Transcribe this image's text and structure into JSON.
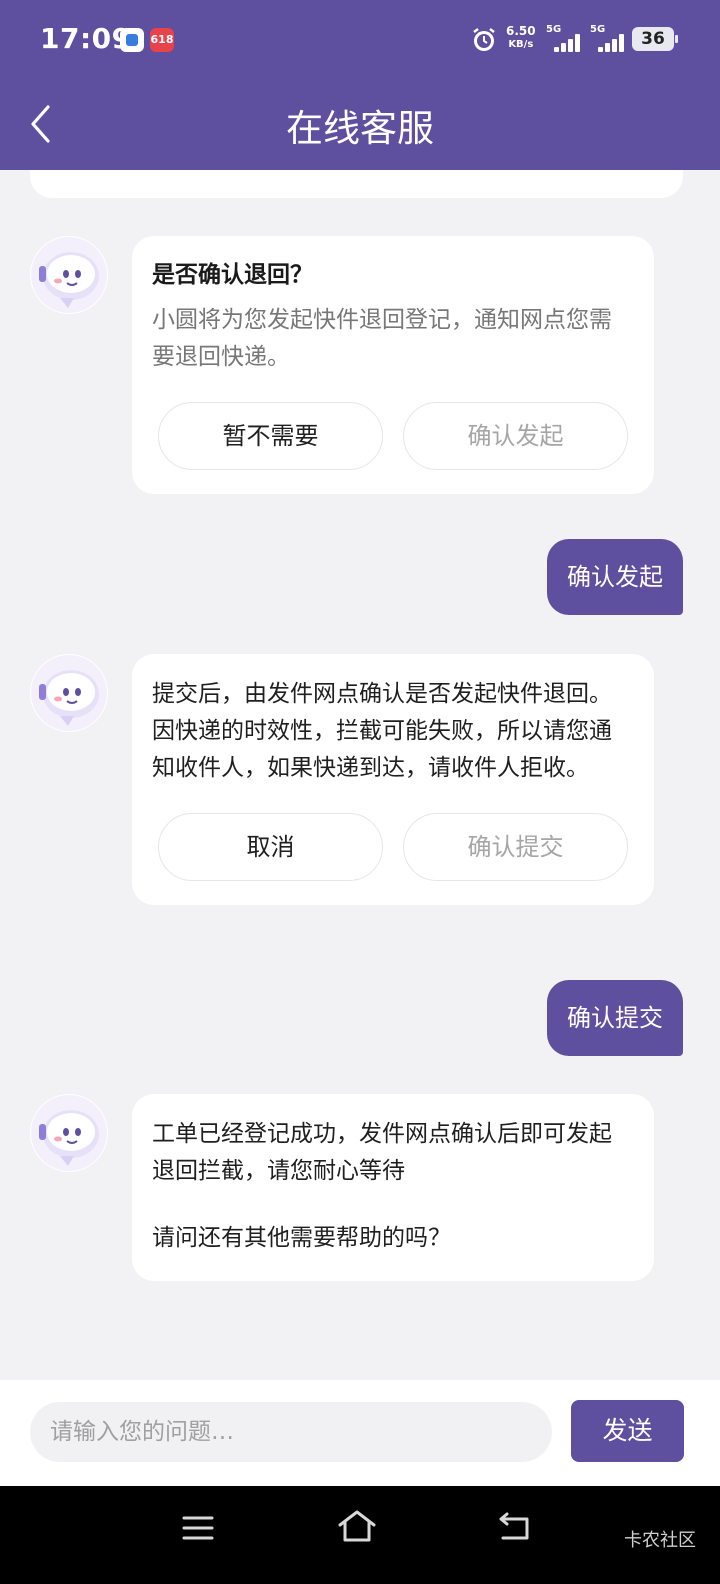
{
  "status_bar": {
    "time": "17:09",
    "app_icon_2_text": "618",
    "net_speed_value": "6.50",
    "net_speed_unit": "KB/s",
    "sim1_label": "5G",
    "sim2_label": "5G",
    "battery_level": "36",
    "icons": [
      "app-notification-icon",
      "shopping-app-icon",
      "alarm-icon",
      "signal-icon",
      "battery-icon"
    ]
  },
  "header": {
    "title": "在线客服",
    "back_icon": "chevron-left-icon"
  },
  "messages": [
    {
      "from": "bot",
      "title": "是否确认退回？",
      "text": "小圆将为您发起快件退回登记，通知网点您需要退回快递。",
      "buttons": [
        "暂不需要",
        "确认发起"
      ]
    },
    {
      "from": "user",
      "text": "确认发起"
    },
    {
      "from": "bot",
      "text": "提交后，由发件网点确认是否发起快件退回。因快递的时效性，拦截可能失败，所以请您通知收件人，如果快递到达，请收件人拒收。",
      "buttons": [
        "取消",
        "确认提交"
      ]
    },
    {
      "from": "user",
      "text": "确认提交"
    },
    {
      "from": "bot",
      "text": "工单已经登记成功，发件网点确认后即可发起退回拦截，请您耐心等待",
      "text2": "请问还有其他需要帮助的吗？"
    }
  ],
  "input_bar": {
    "placeholder": "请输入您的问题…",
    "send_label": "发送"
  },
  "nav_bar": {
    "icons": [
      "menu-icon",
      "home-icon",
      "back-nav-icon"
    ],
    "watermark": "卡农社区"
  },
  "colors": {
    "brand": "#5e509f",
    "background": "#f2f2f4",
    "muted_text": "#777777",
    "disabled_text": "#a6a6a6"
  }
}
